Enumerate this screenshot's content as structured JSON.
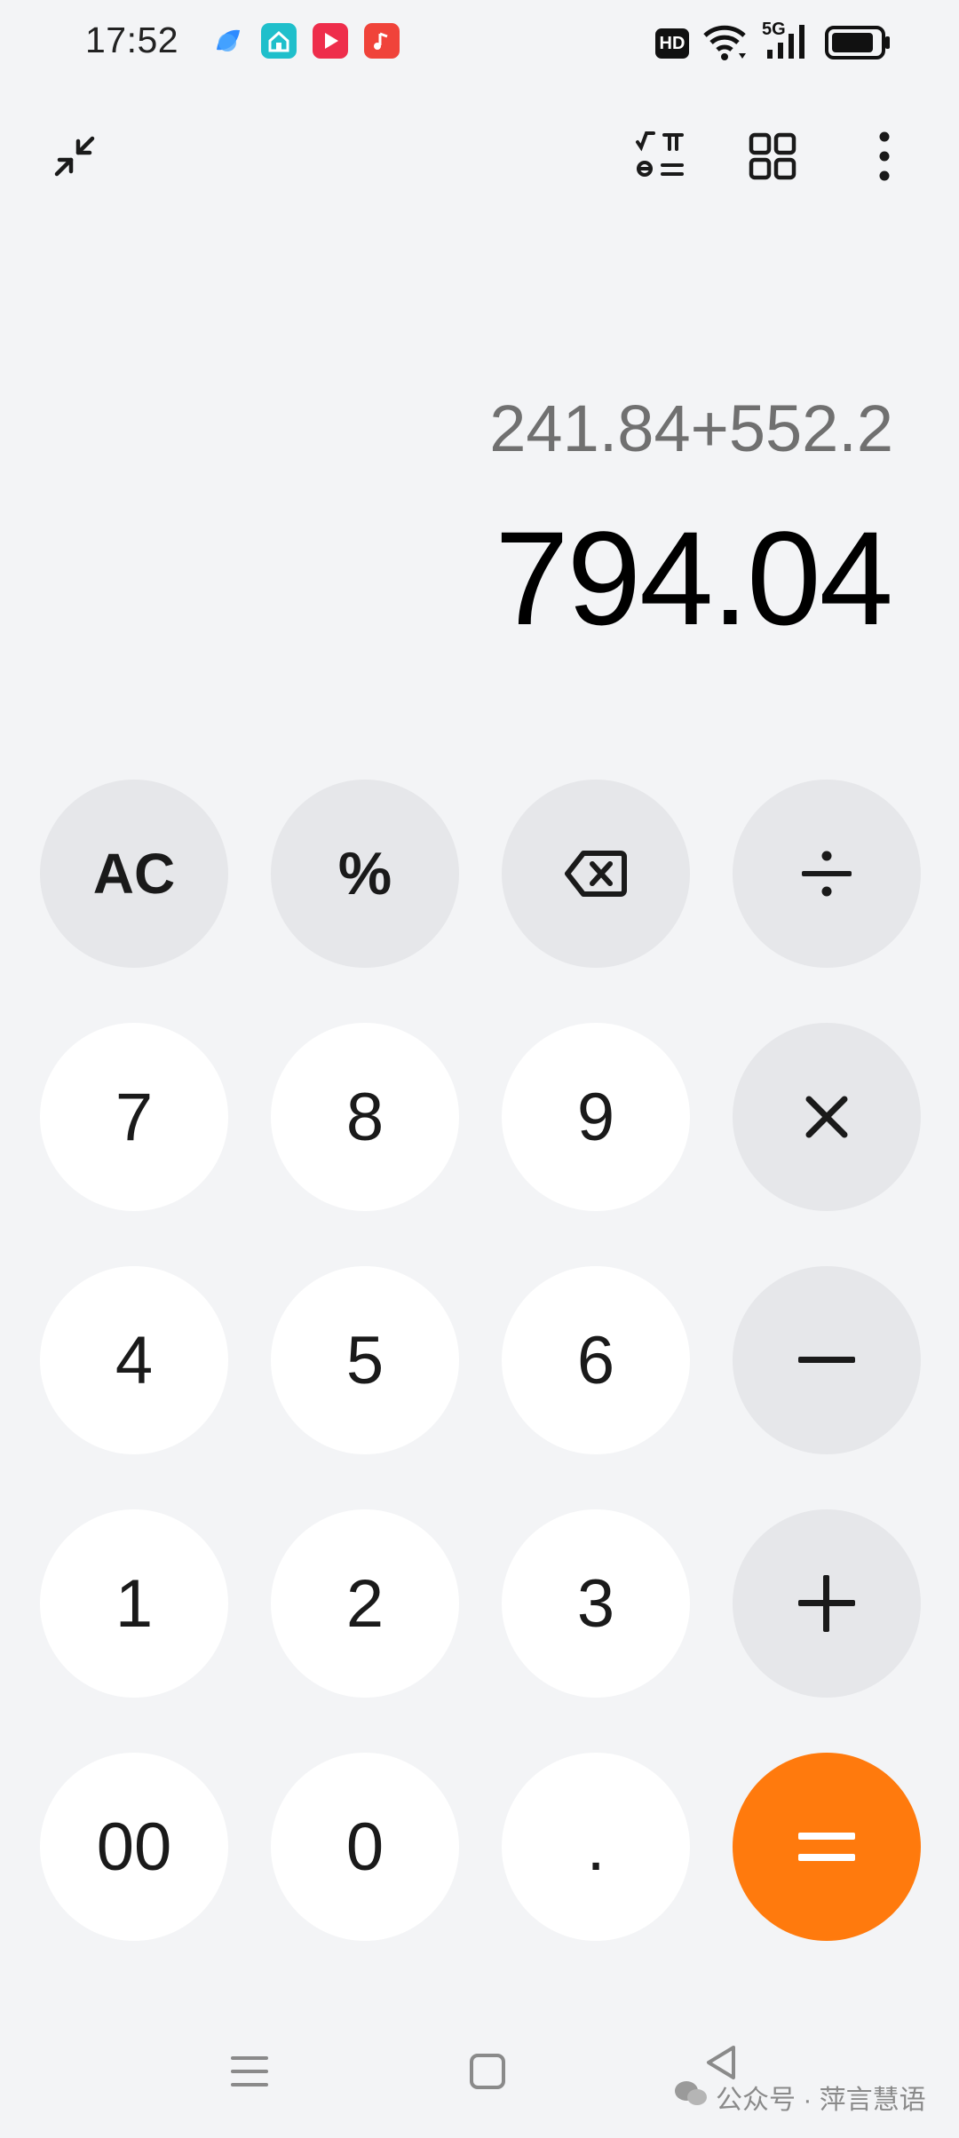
{
  "status_bar": {
    "time": "17:52",
    "hd_badge": "HD",
    "network": "5G",
    "app_icons": [
      "browser-icon",
      "smart-home-icon",
      "video-player-icon",
      "music-icon"
    ]
  },
  "toolbar": {
    "icons": [
      "collapse-icon",
      "scientific-mode-icon",
      "converter-grid-icon",
      "more-options-icon"
    ]
  },
  "display": {
    "expression": "241.84+552.2",
    "result": "794.04"
  },
  "keys": {
    "ac": "AC",
    "percent": "%",
    "seven": "7",
    "eight": "8",
    "nine": "9",
    "four": "4",
    "five": "5",
    "six": "6",
    "one": "1",
    "two": "2",
    "three": "3",
    "double_zero": "00",
    "zero": "0",
    "decimal": "."
  },
  "nav_bar": {
    "icons": [
      "menu-icon",
      "home-icon",
      "back-icon"
    ]
  },
  "watermark": {
    "text": "公众号 · 萍言慧语"
  },
  "colors": {
    "background": "#f3f4f6",
    "number_key": "#ffffff",
    "function_key": "#e6e7ea",
    "equals_key": "#ff7a0d",
    "expression_text": "#707070"
  }
}
